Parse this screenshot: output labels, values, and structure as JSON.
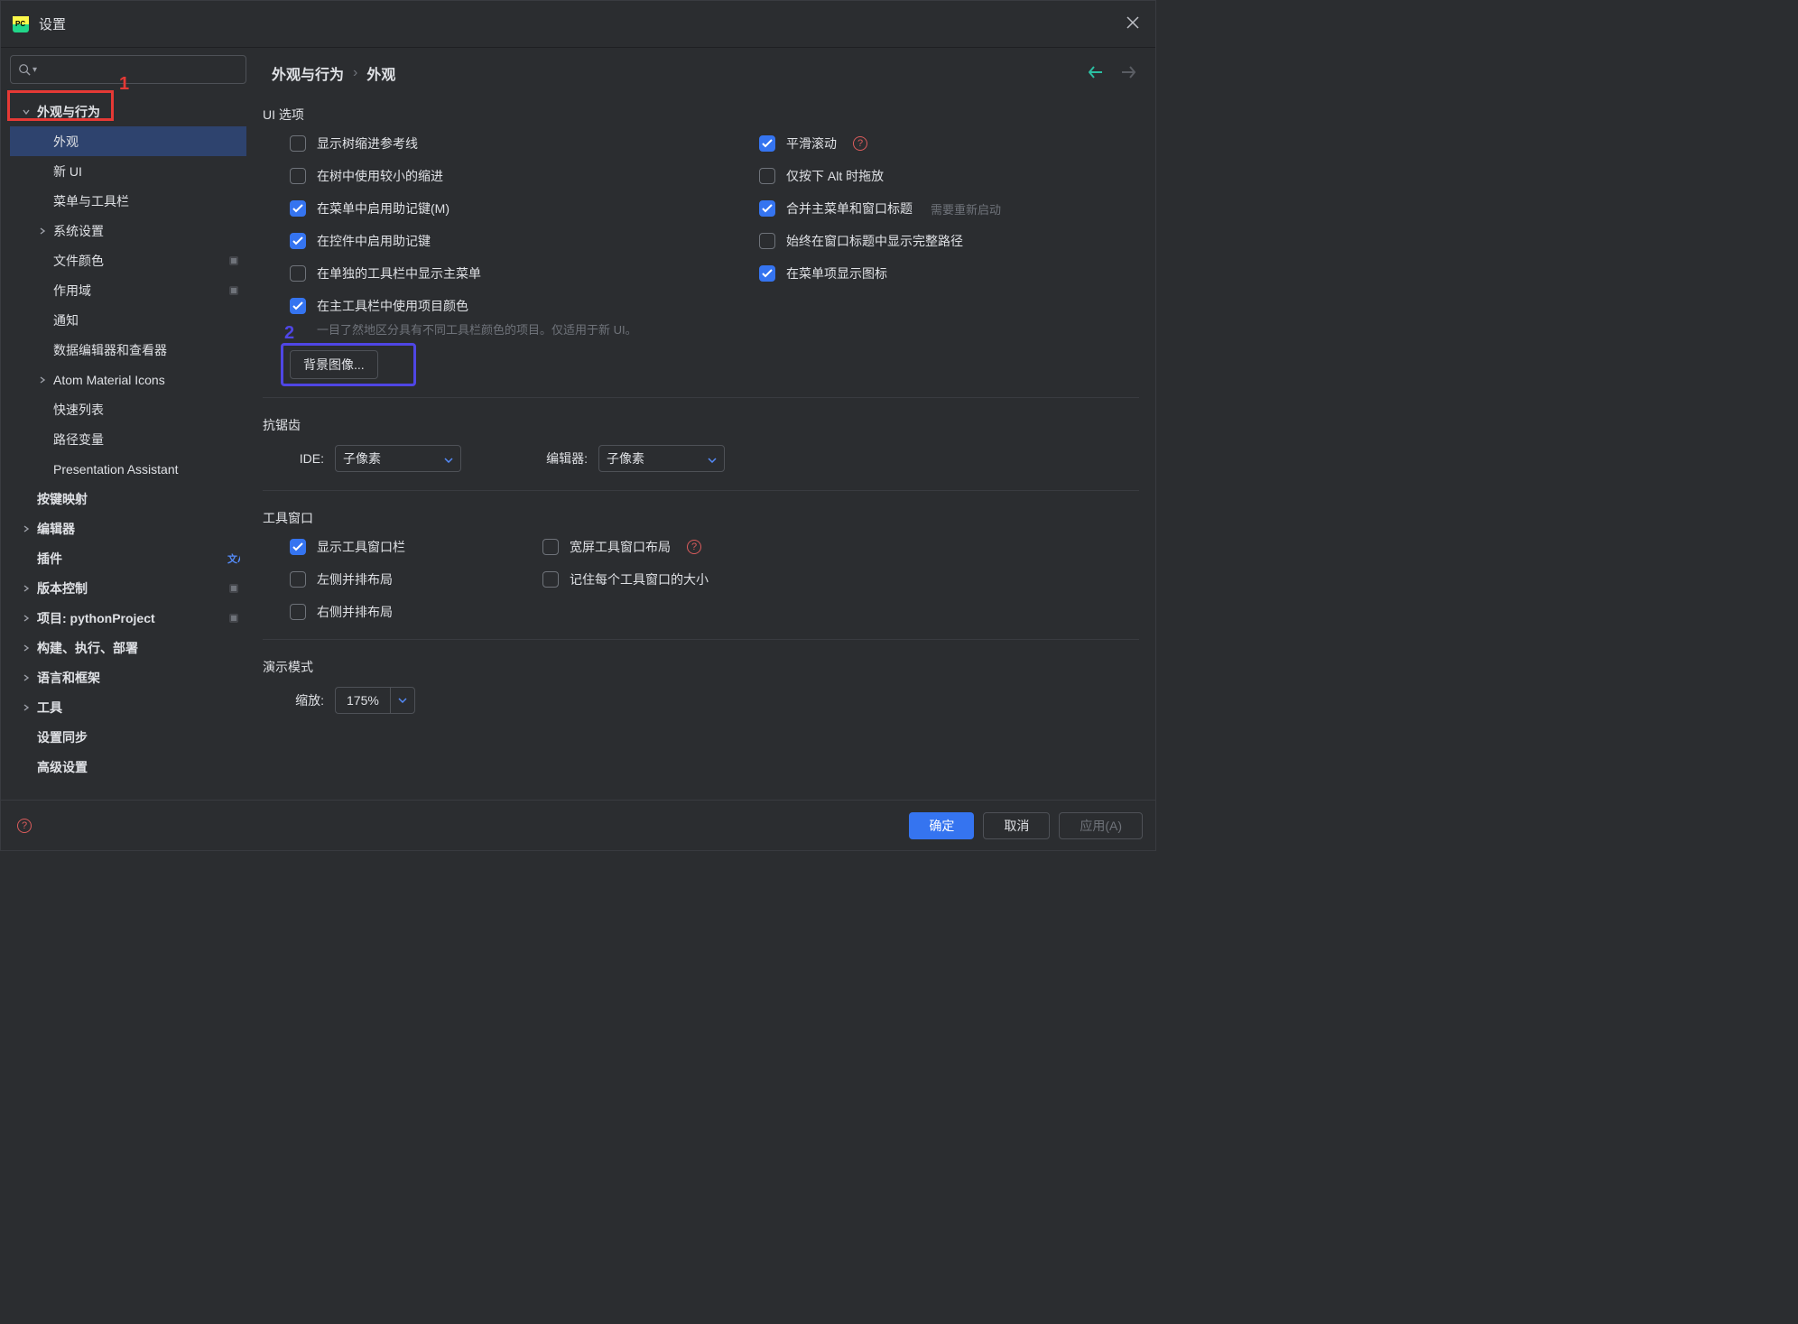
{
  "titlebar": {
    "title": "设置"
  },
  "search": {
    "placeholder": ""
  },
  "annotations": {
    "one": "1",
    "two": "2"
  },
  "sidebar": {
    "items": [
      {
        "label": "外观与行为",
        "level": 0,
        "chev": "down",
        "bold": true
      },
      {
        "label": "外观",
        "level": 1,
        "selected": true
      },
      {
        "label": "新 UI",
        "level": 1
      },
      {
        "label": "菜单与工具栏",
        "level": 1
      },
      {
        "label": "系统设置",
        "level": 1,
        "chev": "right"
      },
      {
        "label": "文件颜色",
        "level": 1,
        "trailing": "proj"
      },
      {
        "label": "作用域",
        "level": 1,
        "trailing": "proj"
      },
      {
        "label": "通知",
        "level": 1
      },
      {
        "label": "数据编辑器和查看器",
        "level": 1
      },
      {
        "label": "Atom Material Icons",
        "level": 1,
        "chev": "right"
      },
      {
        "label": "快速列表",
        "level": 1
      },
      {
        "label": "路径变量",
        "level": 1
      },
      {
        "label": "Presentation Assistant",
        "level": 1
      },
      {
        "label": "按键映射",
        "level": 0,
        "bold": true
      },
      {
        "label": "编辑器",
        "level": 0,
        "chev": "right",
        "bold": true
      },
      {
        "label": "插件",
        "level": 0,
        "bold": true,
        "trailing": "translate"
      },
      {
        "label": "版本控制",
        "level": 0,
        "chev": "right",
        "bold": true,
        "trailing": "proj"
      },
      {
        "label": "项目: pythonProject",
        "level": 0,
        "chev": "right",
        "bold": true,
        "trailing": "proj"
      },
      {
        "label": "构建、执行、部署",
        "level": 0,
        "chev": "right",
        "bold": true
      },
      {
        "label": "语言和框架",
        "level": 0,
        "chev": "right",
        "bold": true
      },
      {
        "label": "工具",
        "level": 0,
        "chev": "right",
        "bold": true
      },
      {
        "label": "设置同步",
        "level": 0,
        "bold": true
      },
      {
        "label": "高级设置",
        "level": 0,
        "bold": true
      }
    ]
  },
  "breadcrumb": {
    "part1": "外观与行为",
    "part2": "外观"
  },
  "sections": {
    "ui_options": {
      "heading": "UI 选项",
      "left": [
        {
          "label": "显示树缩进参考线",
          "checked": false
        },
        {
          "label": "在树中使用较小的缩进",
          "checked": false
        },
        {
          "label": "在菜单中启用助记键(M)",
          "checked": true
        },
        {
          "label": "在控件中启用助记键",
          "checked": true
        },
        {
          "label": "在单独的工具栏中显示主菜单",
          "checked": false
        },
        {
          "label": "在主工具栏中使用项目颜色",
          "checked": true
        }
      ],
      "right": [
        {
          "label": "平滑滚动",
          "checked": true,
          "help": true
        },
        {
          "label": "仅按下 Alt 时拖放",
          "checked": false
        },
        {
          "label": "合并主菜单和窗口标题",
          "checked": true,
          "hint": "需要重新启动"
        },
        {
          "label": "始终在窗口标题中显示完整路径",
          "checked": false
        },
        {
          "label": "在菜单项显示图标",
          "checked": true
        }
      ],
      "hint_below": "一目了然地区分具有不同工具栏颜色的项目。仅适用于新 UI。",
      "bg_btn": "背景图像..."
    },
    "antialias": {
      "heading": "抗锯齿",
      "ide_label": "IDE:",
      "ide_value": "子像素",
      "editor_label": "编辑器:",
      "editor_value": "子像素"
    },
    "tool_windows": {
      "heading": "工具窗口",
      "left": [
        {
          "label": "显示工具窗口栏",
          "checked": true
        },
        {
          "label": "左侧并排布局",
          "checked": false
        },
        {
          "label": "右侧并排布局",
          "checked": false
        }
      ],
      "right": [
        {
          "label": "宽屏工具窗口布局",
          "checked": false,
          "help": true
        },
        {
          "label": "记住每个工具窗口的大小",
          "checked": false
        }
      ]
    },
    "presentation": {
      "heading": "演示模式",
      "zoom_label": "缩放:",
      "zoom_value": "175%"
    }
  },
  "footer": {
    "ok": "确定",
    "cancel": "取消",
    "apply": "应用(A)"
  }
}
